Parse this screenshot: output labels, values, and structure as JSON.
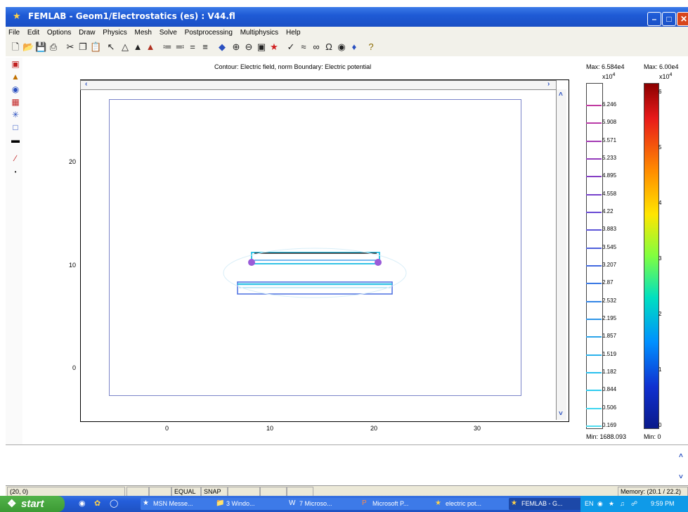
{
  "window": {
    "title": "FEMLAB - Geom1/Electrostatics (es) : V44.fl"
  },
  "menu": [
    "File",
    "Edit",
    "Options",
    "Draw",
    "Physics",
    "Mesh",
    "Solve",
    "Postprocessing",
    "Multiphysics",
    "Help"
  ],
  "plot": {
    "title": "Contour: Electric field, norm  Boundary: Electric potential",
    "x_ticks": [
      "0",
      "10",
      "20",
      "30"
    ],
    "y_ticks": [
      "20",
      "10",
      "0"
    ]
  },
  "colorbar_contour": {
    "max_label": "Max: 6.584e4",
    "min_label": "Min: 1688.093",
    "multiplier": "x10",
    "exponent": "4",
    "ticks": [
      "6.246",
      "5.908",
      "5.571",
      "5.233",
      "4.895",
      "4.558",
      "4.22",
      "3.883",
      "3.545",
      "3.207",
      "2.87",
      "2.532",
      "2.195",
      "1.857",
      "1.519",
      "1.182",
      "0.844",
      "0.506",
      "0.169"
    ]
  },
  "colorbar_boundary": {
    "max_label": "Max: 6.00e4",
    "min_label": "Min: 0",
    "multiplier": "x10",
    "exponent": "4",
    "ticks": [
      "6",
      "5",
      "4",
      "3",
      "2",
      "1",
      "0"
    ]
  },
  "status": {
    "coords": "(20, 0)",
    "equal": "EQUAL",
    "snap": "SNAP",
    "memory": "Memory: (20.1 / 22.2)"
  },
  "taskbar": {
    "start": "start",
    "tasks": [
      "MSN Messe...",
      "3 Windo...",
      "7 Microso...",
      "Microsoft P...",
      "electric pot...",
      "FEMLAB - G..."
    ],
    "lang": "EN",
    "clock": "9:59 PM"
  }
}
